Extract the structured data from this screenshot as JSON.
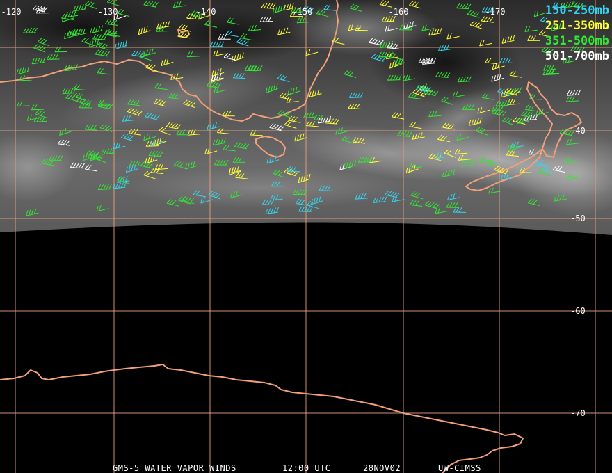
{
  "footer": {
    "product": "GMS-5 WATER VAPOR WINDS",
    "time": "12:00 UTC",
    "date": "28NOV02",
    "source": "UW-CIMSS"
  },
  "legend": [
    {
      "label": "150-250mb",
      "color": "#33d6f2"
    },
    {
      "label": "251-350mb",
      "color": "#ffff33"
    },
    {
      "label": "351-500mb",
      "color": "#33e633"
    },
    {
      "label": "501-700mb",
      "color": "#ffffff"
    }
  ],
  "longitude_labels": [
    "-120",
    "-130",
    "-140",
    "-150",
    "-160",
    "-170"
  ],
  "latitude_labels": [
    "-40",
    "-50",
    "-60",
    "-70"
  ],
  "colors": {
    "grid": "#e8a27c",
    "coastline": "#f2a07a",
    "space": "#000000"
  }
}
